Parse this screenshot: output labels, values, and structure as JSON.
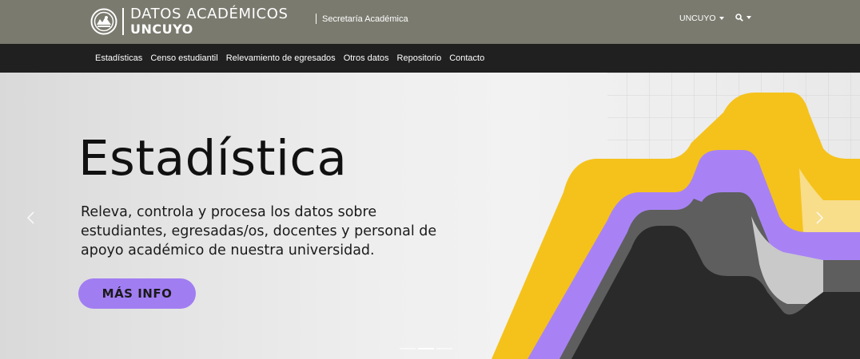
{
  "header": {
    "logo_line1": "DATOS ACADÉMICOS",
    "logo_line2": "UNCUYO",
    "secretaria": "Secretaría Académica",
    "uncuyo_menu": "UNCUYO",
    "search_icon": "search-icon"
  },
  "nav": {
    "items": [
      {
        "label": "Estadísticas"
      },
      {
        "label": "Censo estudiantil"
      },
      {
        "label": "Relevamiento de egresados"
      },
      {
        "label": "Otros datos"
      },
      {
        "label": "Repositorio"
      },
      {
        "label": "Contacto"
      }
    ]
  },
  "hero": {
    "title": "Estadística",
    "description": "Releva, controla y procesa los datos sobre estudiantes, egresadas/os, docentes y personal de apoyo académico de nuestra universidad.",
    "button": "MÁS INFO",
    "prev_icon": "chevron-left-icon",
    "next_icon": "chevron-right-icon"
  },
  "colors": {
    "topbar": "#7a7a6f",
    "navbar": "#202020",
    "button": "#a17df2",
    "yellow": "#f5c21c",
    "purple": "#a882f5",
    "gray": "#666666",
    "black": "#2a2a2a"
  }
}
